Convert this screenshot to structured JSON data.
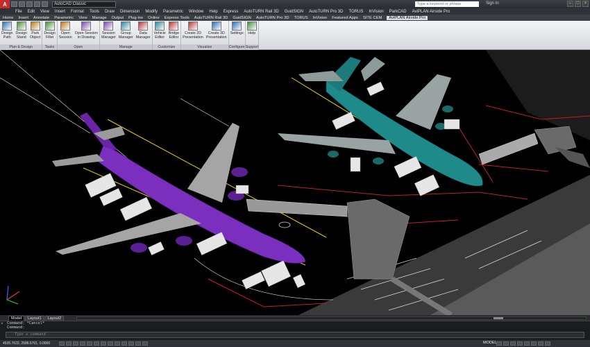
{
  "title_bar": {
    "workspace": "AutoCAD Classic",
    "search_placeholder": "Type a keyword or phrase",
    "sign_in": "Sign In"
  },
  "menu": [
    "File",
    "Edit",
    "View",
    "Insert",
    "Format",
    "Tools",
    "Draw",
    "Dimension",
    "Modify",
    "Parametric",
    "Window",
    "Help",
    "Express",
    "AutoTURN Rail 3D",
    "GuidSIGN",
    "AutoTURN Pro 3D",
    "TORUS",
    "InVision",
    "ParkCAD",
    "AviPLAN Airside Pro"
  ],
  "ribbon_tabs": [
    "Home",
    "Insert",
    "Annotate",
    "Parametric",
    "View",
    "Manage",
    "Output",
    "Plug-ins",
    "Online",
    "Express Tools",
    "AutoTURN Rail 3D",
    "GuidSIGN",
    "AutoTURN Pro 3D",
    "TORUS",
    "InVision",
    "Featured Apps",
    "SITE CEM",
    "AviPLAN Airside Pro"
  ],
  "active_tab": "AviPLAN Airside Pro",
  "ribbon_groups": [
    {
      "title": "Plan & Design",
      "buttons": [
        "Design\nPath",
        "Design\nStand",
        "Park\nObject"
      ]
    },
    {
      "title": "Tasks",
      "buttons": [
        "Design\nFillet"
      ]
    },
    {
      "title": "Open",
      "buttons": [
        "Open\nSession",
        "Open Session\nin Drawing"
      ]
    },
    {
      "title": "Manage",
      "buttons": [
        "Session\nManager",
        "Group\nManager",
        "Data\nManager"
      ]
    },
    {
      "title": "Customize",
      "buttons": [
        "Vehicle\nEditor",
        "Bridge\nEditor"
      ]
    },
    {
      "title": "Visualize",
      "buttons": [
        "Create 2D\nPresentation",
        "Create 3D\nPresentation"
      ]
    },
    {
      "title": "Configure",
      "buttons": [
        "Settings"
      ]
    },
    {
      "title": "Support",
      "buttons": [
        "Help"
      ]
    }
  ],
  "layout_tabs": [
    "Model",
    "Layout1",
    "Layout2"
  ],
  "active_layout": "Model",
  "command_history": [
    "Command: *Cancel*",
    "Command:"
  ],
  "command_placeholder": "Type a command",
  "coordinates": "4535.7622, 2586.6701, 0.0000",
  "status_model": "MODEL",
  "colors": {
    "aircraft_1": "#7a2fbf",
    "aircraft_2": "#1f8a8a",
    "ribbon_bg": "#e6e8eb",
    "title_bg": "#2f3238",
    "linework_red": "#c0202a"
  },
  "viewport_image": "3D airport apron scene with two aircraft at jet bridges"
}
